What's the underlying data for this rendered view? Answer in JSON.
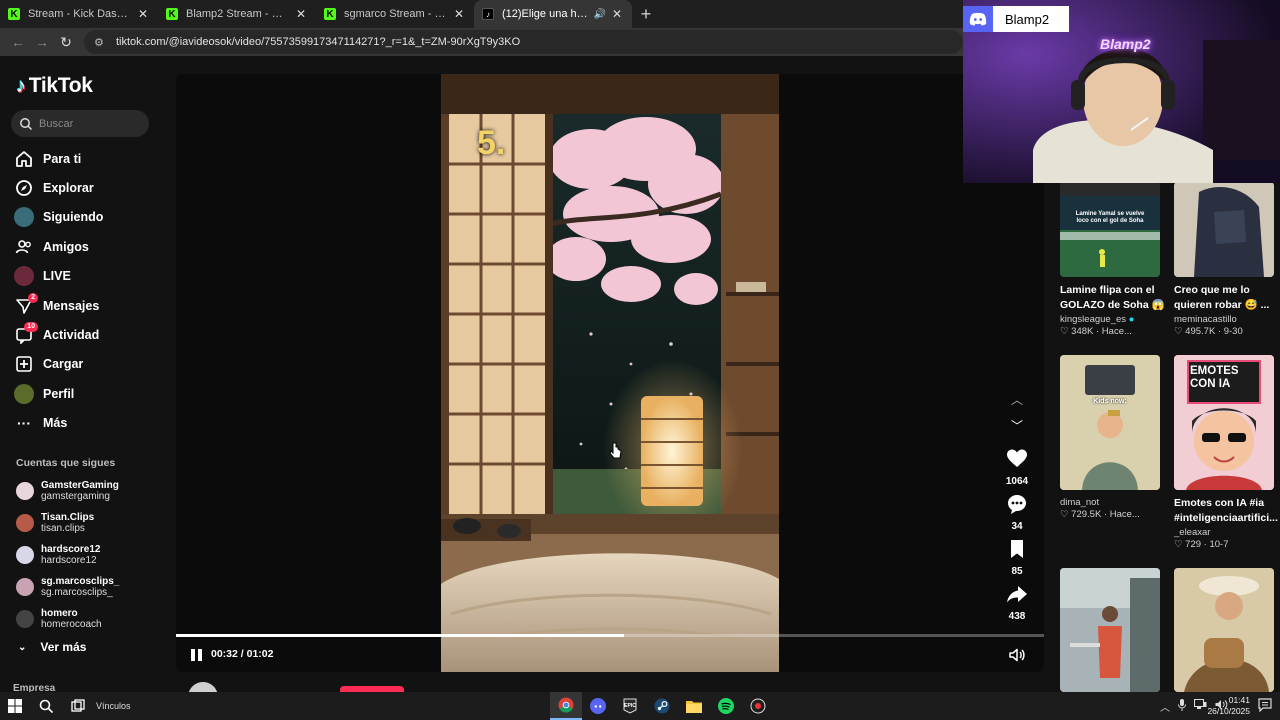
{
  "browser": {
    "tabs": [
      {
        "title": "Stream - Kick Dashboard",
        "favicon": "kick-icon",
        "active": false
      },
      {
        "title": "Blamp2 Stream - Watch Live on",
        "favicon": "kick-icon",
        "active": false
      },
      {
        "title": "sgmarco Stream - Watch Live o",
        "favicon": "kick-icon",
        "active": false
      },
      {
        "title": "(12)Elige una habitacion #",
        "favicon": "tiktok-icon",
        "active": true
      }
    ],
    "url": "tiktok.com/@iavideosok/video/7557359917347114271?_r=1&_t=ZM-90rXgT9y3KO"
  },
  "tiktok": {
    "brand": "TikTok",
    "search_placeholder": "Buscar",
    "nav": [
      {
        "label": "Para ti",
        "icon": "home-icon"
      },
      {
        "label": "Explorar",
        "icon": "compass-icon"
      },
      {
        "label": "Siguiendo",
        "icon": "following-avatar-icon"
      },
      {
        "label": "Amigos",
        "icon": "friends-icon"
      },
      {
        "label": "LIVE",
        "icon": "live-icon"
      },
      {
        "label": "Mensajes",
        "icon": "messages-icon",
        "badge": "2"
      },
      {
        "label": "Actividad",
        "icon": "activity-icon",
        "badge": "10"
      },
      {
        "label": "Cargar",
        "icon": "upload-icon"
      },
      {
        "label": "Perfil",
        "icon": "profile-icon"
      },
      {
        "label": "Más",
        "icon": "more-icon"
      }
    ],
    "following_title": "Cuentas que sigues",
    "following": [
      {
        "name": "GamsterGaming",
        "handle": "gamstergaming",
        "color": "#e8d6dc"
      },
      {
        "name": "Tisan.Clips",
        "handle": "tisan.clips",
        "color": "#b85a4a"
      },
      {
        "name": "hardscore12",
        "handle": "hardscore12",
        "color": "#d7d7e8"
      },
      {
        "name": "sg.marcosclips_",
        "handle": "sg.marcosclips_",
        "color": "#c9a3b4"
      },
      {
        "name": "homero",
        "handle": "homerocoach",
        "color": "#444444"
      }
    ],
    "ver_mas": "Ver más",
    "empresa": "Empresa"
  },
  "video": {
    "overlay_number": "5.",
    "time_current": "00:32",
    "time_separator": "/",
    "time_total": "01:02",
    "progress_fraction": 0.516,
    "likes": "1064",
    "comments": "34",
    "saves": "85",
    "shares": "438",
    "author": "iavideosok"
  },
  "feed": [
    {
      "title": "Lamine flipa con el GOLAZO de Soha 😱",
      "user": "kingsleague_es",
      "verified": true,
      "stat": "348K · Hace..."
    },
    {
      "title": "Creo que me lo quieren robar 😅 ...",
      "user": "meminacastillo",
      "verified": false,
      "stat": "495.7K · 9-30"
    },
    {
      "title": "",
      "user": "dima_not",
      "verified": false,
      "stat": "729.5K · Hace..."
    },
    {
      "title": "Emotes con IA #ia #inteligenciaartifici...",
      "user": "_eleaxar",
      "verified": false,
      "stat": "729 · 10-7"
    },
    {
      "title": "",
      "user": "",
      "verified": false,
      "stat": ""
    },
    {
      "title": "",
      "user": "",
      "verified": false,
      "stat": ""
    }
  ],
  "thumb_texts": {
    "lamine_caption": "Lamine Yamal se vuelve loco con el gol de Soha",
    "kids_now": "Kids now:",
    "emotes_line1": "EMOTES",
    "emotes_line2": "CON IA"
  },
  "stream_overlay": {
    "discord_name": "Blamp2",
    "neon_sign": "Blamp2"
  },
  "taskbar": {
    "links_label": "Vínculos",
    "time": "01:41",
    "date": "26/10/2025"
  },
  "colors": {
    "tiktok_red": "#fe2c55",
    "kick_green": "#53fc18",
    "discord_blurple": "#5865f2"
  }
}
